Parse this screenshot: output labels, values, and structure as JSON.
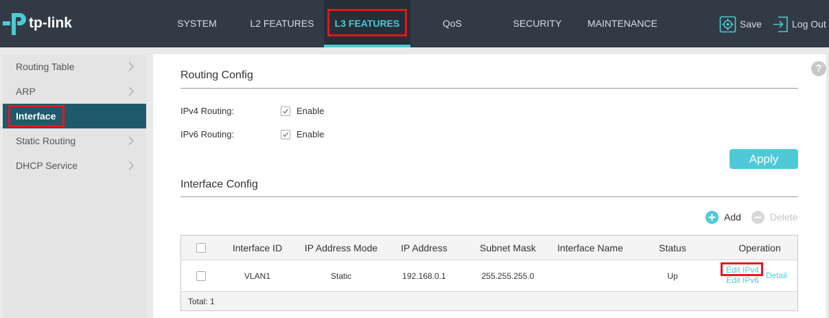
{
  "brand": {
    "name": "tp-link"
  },
  "nav": {
    "items": [
      "SYSTEM",
      "L2 FEATURES",
      "L3 FEATURES",
      "QoS",
      "SECURITY",
      "MAINTENANCE"
    ],
    "active": "L3 FEATURES",
    "save_label": "Save",
    "logout_label": "Log Out"
  },
  "sidebar": {
    "items": [
      {
        "label": "Routing Table",
        "icon": "chevron-right-icon"
      },
      {
        "label": "ARP",
        "icon": "chevron-right-icon"
      },
      {
        "label": "Interface",
        "icon": ""
      },
      {
        "label": "Static Routing",
        "icon": "chevron-right-icon"
      },
      {
        "label": "DHCP Service",
        "icon": "chevron-right-icon"
      }
    ],
    "active": "Interface"
  },
  "main": {
    "help_label": "?",
    "routing_config": {
      "title": "Routing Config",
      "ipv4_label": "IPv4 Routing:",
      "ipv4_enable_label": "Enable",
      "ipv4_enabled": true,
      "ipv6_label": "IPv6 Routing:",
      "ipv6_enable_label": "Enable",
      "ipv6_enabled": true,
      "apply_label": "Apply"
    },
    "interface_config": {
      "title": "Interface Config",
      "add_label": "Add",
      "delete_label": "Delete",
      "columns": [
        "Interface ID",
        "IP Address Mode",
        "IP Address",
        "Subnet Mask",
        "Interface Name",
        "Status",
        "Operation"
      ],
      "rows": [
        {
          "interface_id": "VLAN1",
          "ip_mode": "Static",
          "ip_address": "192.168.0.1",
          "subnet_mask": "255.255.255.0",
          "interface_name": "",
          "status": "Up",
          "operations": [
            "Edit IPv4",
            "Edit IPv6",
            "Detail"
          ]
        }
      ],
      "total_label": "Total: 1"
    }
  },
  "colors": {
    "topbar": "#323b45",
    "accent": "#4acbd6",
    "sidebar_active": "#1f5a6c",
    "highlight": "#e8161a"
  }
}
